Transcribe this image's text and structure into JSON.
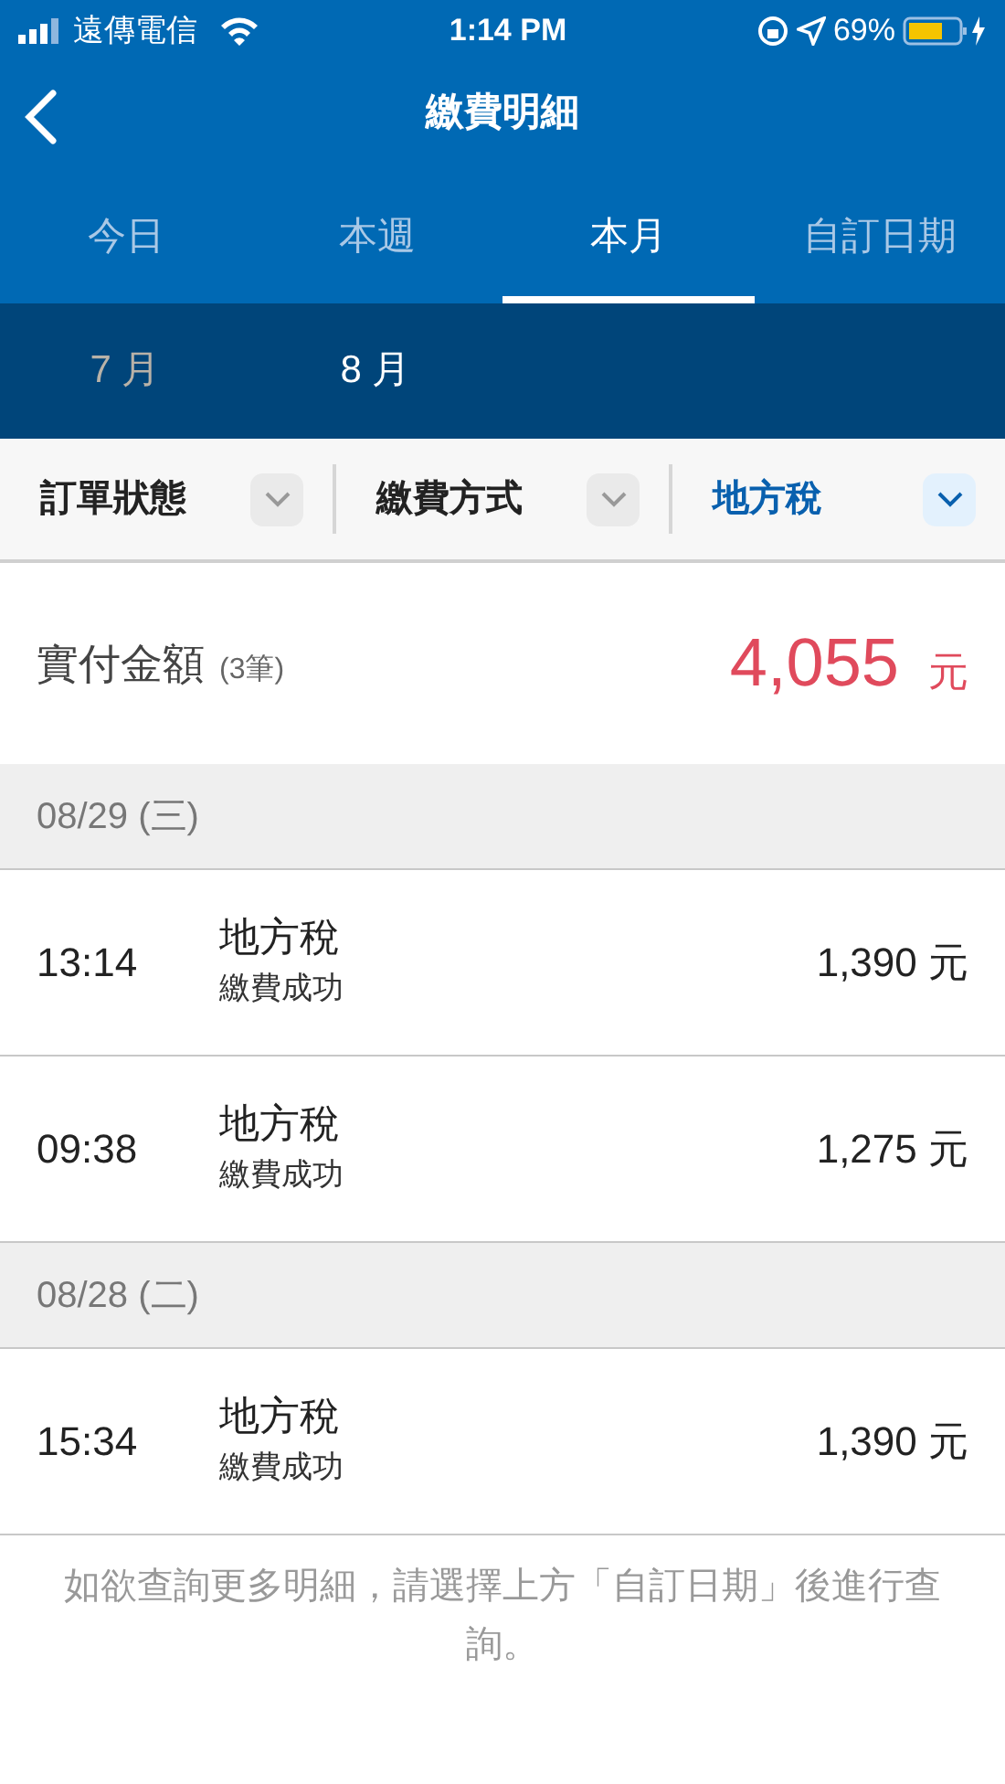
{
  "status_bar": {
    "carrier": "遠傳電信",
    "time": "1:14 PM",
    "battery": "69%"
  },
  "header": {
    "title": "繳費明細"
  },
  "tabs": [
    {
      "label": "今日",
      "selected": false
    },
    {
      "label": "本週",
      "selected": false
    },
    {
      "label": "本月",
      "selected": true
    },
    {
      "label": "自訂日期",
      "selected": false
    }
  ],
  "months": [
    {
      "label": "7 月",
      "selected": false
    },
    {
      "label": "8 月",
      "selected": true
    }
  ],
  "filters": [
    {
      "label": "訂單狀態",
      "active": false
    },
    {
      "label": "繳費方式",
      "active": false
    },
    {
      "label": "地方稅",
      "active": true
    }
  ],
  "total": {
    "label": "實付金額",
    "count": "(3筆)",
    "amount": "4,055",
    "unit": "元"
  },
  "groups": [
    {
      "date": "08/29 (三)",
      "rows": [
        {
          "time": "13:14",
          "title": "地方稅",
          "status": "繳費成功",
          "amount": "1,390 元"
        },
        {
          "time": "09:38",
          "title": "地方稅",
          "status": "繳費成功",
          "amount": "1,275 元"
        }
      ]
    },
    {
      "date": "08/28 (二)",
      "rows": [
        {
          "time": "15:34",
          "title": "地方稅",
          "status": "繳費成功",
          "amount": "1,390 元"
        }
      ]
    }
  ],
  "footer_note": "如欲查詢更多明細，請選擇上方「自訂日期」後進行查詢。"
}
